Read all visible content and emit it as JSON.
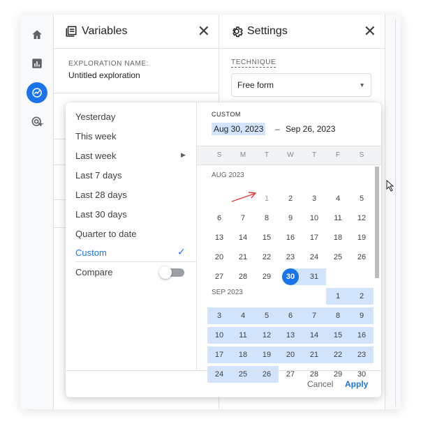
{
  "rail": {
    "icons": [
      "home-icon",
      "bar-chart-icon",
      "explore-icon",
      "ads-icon"
    ]
  },
  "variables": {
    "title": "Variables",
    "exploration_name_label": "EXPLORATION NAME:",
    "exploration_name": "Untitled exploration"
  },
  "settings": {
    "title": "Settings",
    "technique_label": "TECHNIQUE",
    "technique_value": "Free form"
  },
  "date_picker": {
    "presets": [
      "Yesterday",
      "This week",
      "Last week",
      "Last 7 days",
      "Last 28 days",
      "Last 30 days",
      "Quarter to date",
      "Custom"
    ],
    "selected_preset": "Custom",
    "compare_label": "Compare",
    "compare_on": false,
    "custom_label": "CUSTOM",
    "start_date": "Aug 30, 2023",
    "range_separator": "–",
    "end_date": "Sep 26, 2023",
    "weekdays": [
      "S",
      "M",
      "T",
      "W",
      "T",
      "F",
      "S"
    ],
    "months": [
      {
        "label": "AUG 2023",
        "first_weekday": 2,
        "days": 31,
        "in_range_from": 30
      },
      {
        "label": "SEP 2023",
        "first_weekday": 5,
        "days": 30,
        "in_range_to": 26
      }
    ],
    "cancel_label": "Cancel",
    "apply_label": "Apply",
    "accent": "#1a73e8",
    "range_color": "#d2e3fc"
  }
}
